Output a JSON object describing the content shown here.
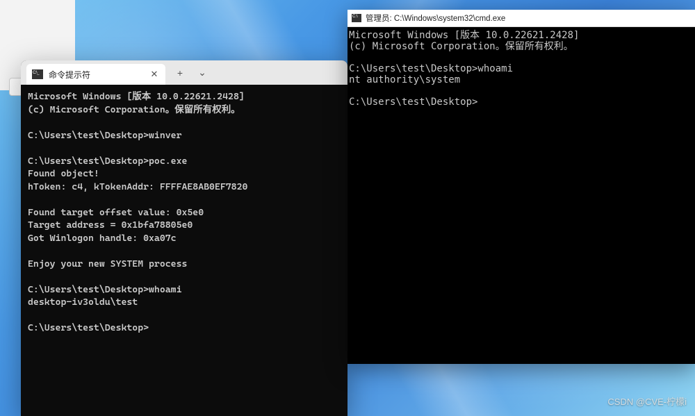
{
  "wallpaper": "windows-11-bloom",
  "side": {
    "placeholder": ""
  },
  "terminal": {
    "tab_icon": "cmd-icon",
    "tab_title": "命令提示符",
    "close_glyph": "✕",
    "add_glyph": "+",
    "chevron_glyph": "⌄",
    "lines": [
      "Microsoft Windows [版本 10.0.22621.2428]",
      "(c) Microsoft Corporation。保留所有权利。",
      "",
      "C:\\Users\\test\\Desktop>winver",
      "",
      "C:\\Users\\test\\Desktop>poc.exe",
      "Found object!",
      "hToken: c4, kTokenAddr: FFFFAE8AB0EF7820",
      "",
      "Found target offset value: 0x5e0",
      "Target address = 0x1bfa78805e0",
      "Got Winlogon handle: 0xa07c",
      "",
      "Enjoy your new SYSTEM process",
      "",
      "C:\\Users\\test\\Desktop>whoami",
      "desktop-iv3oldu\\test",
      "",
      "C:\\Users\\test\\Desktop>"
    ]
  },
  "cmd": {
    "title": "管理员: C:\\Windows\\system32\\cmd.exe",
    "lines": [
      "Microsoft Windows [版本 10.0.22621.2428]",
      "(c) Microsoft Corporation。保留所有权利。",
      "",
      "C:\\Users\\test\\Desktop>whoami",
      "nt authority\\system",
      "",
      "C:\\Users\\test\\Desktop>"
    ]
  },
  "watermark": "CSDN @CVE-柠檬i"
}
